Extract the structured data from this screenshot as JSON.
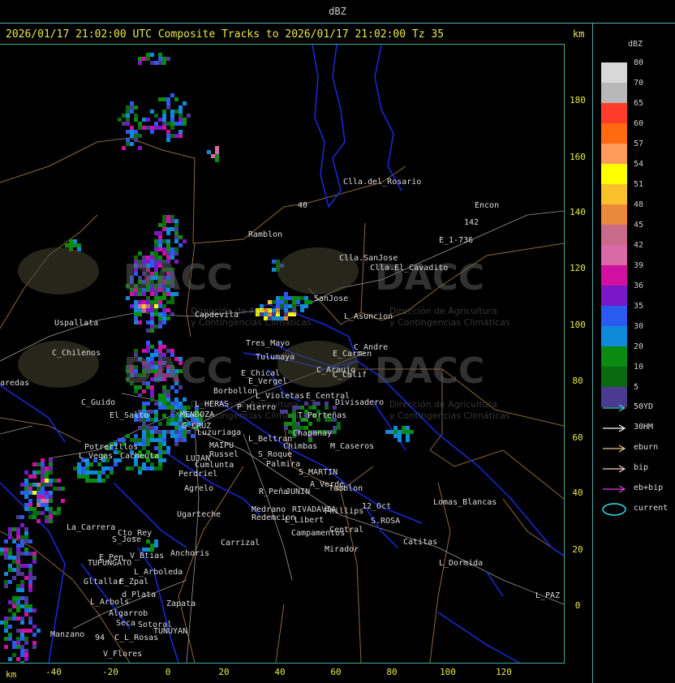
{
  "window": {
    "title": "dBZ"
  },
  "header": {
    "text": "2026/01/17 21:02:00 UTC Composite Tracks to 2026/01/17 21:02:00 Tz 35",
    "km_label": "km"
  },
  "axes": {
    "x_unit": "km",
    "x_ticks": [
      "-40",
      "-20",
      "0",
      "20",
      "40",
      "60",
      "80",
      "100",
      "120"
    ],
    "y_ticks": [
      "180",
      "160",
      "140",
      "120",
      "100",
      "80",
      "60",
      "40",
      "20",
      "0"
    ]
  },
  "legend": {
    "title": "dBZ",
    "scale": [
      {
        "value": "80",
        "color": "#d8d8d8"
      },
      {
        "value": "70",
        "color": "#b8b8b8"
      },
      {
        "value": "65",
        "color": "#ff3c2a"
      },
      {
        "value": "60",
        "color": "#ff6a10"
      },
      {
        "value": "57",
        "color": "#ff9a5a"
      },
      {
        "value": "54",
        "color": "#ffff00"
      },
      {
        "value": "51",
        "color": "#f8c02a"
      },
      {
        "value": "48",
        "color": "#e88a3a"
      },
      {
        "value": "45",
        "color": "#c86a8a"
      },
      {
        "value": "42",
        "color": "#d86aa8"
      },
      {
        "value": "39",
        "color": "#d010a0"
      },
      {
        "value": "36",
        "color": "#7a18c8"
      },
      {
        "value": "35",
        "color": "#2a5af0"
      },
      {
        "value": "30",
        "color": "#108ad8"
      },
      {
        "value": "20",
        "color": "#0a8a10"
      },
      {
        "value": "10",
        "color": "#0a6a10"
      },
      {
        "value": "5",
        "color": "#4a3a90"
      }
    ],
    "tracks": [
      {
        "label": "50YD",
        "color": "#40d0d8"
      },
      {
        "label": "30HM",
        "color": "#ffffff"
      },
      {
        "label": "eburn",
        "color": "#e8c890"
      },
      {
        "label": "bip",
        "color": "#f8d0d8"
      },
      {
        "label": "eb+bip",
        "color": "#e040e0"
      },
      {
        "label": "current",
        "color": "#30e0f0"
      }
    ]
  },
  "watermark": {
    "name": "DACC",
    "line1": "Dirección de Agricultura",
    "line2": "y Contingencias Climáticas"
  },
  "places": [
    {
      "name": "Clla.del_Rosario"
    },
    {
      "name": "Encon"
    },
    {
      "name": "142"
    },
    {
      "name": "E_1-736"
    },
    {
      "name": "Ramblon"
    },
    {
      "name": "Clla.SanJose"
    },
    {
      "name": "Clla.El_Cavadito"
    },
    {
      "name": "SanJose"
    },
    {
      "name": "Capdevila"
    },
    {
      "name": "L_Asuncion"
    },
    {
      "name": "Uspallata"
    },
    {
      "name": "Tres_Mayo"
    },
    {
      "name": "C_Andre"
    },
    {
      "name": "Tulumaya"
    },
    {
      "name": "E_Carmen"
    },
    {
      "name": "C_Chilenos"
    },
    {
      "name": "C_Araujo"
    },
    {
      "name": "C_Calif"
    },
    {
      "name": "E_Chical"
    },
    {
      "name": "E_Vergel"
    },
    {
      "name": "aredas"
    },
    {
      "name": "Borbollon"
    },
    {
      "name": "L_Violetas"
    },
    {
      "name": "E_Central"
    },
    {
      "name": "Divisadero"
    },
    {
      "name": "C_Guido"
    },
    {
      "name": "L_HERAS"
    },
    {
      "name": "P_Hierro"
    },
    {
      "name": "El_Salto"
    },
    {
      "name": "MENDOZA"
    },
    {
      "name": "T_Porteñas"
    },
    {
      "name": "G_CRUZ"
    },
    {
      "name": "Luzuriaga"
    },
    {
      "name": "Chapanay"
    },
    {
      "name": "L_Beltran"
    },
    {
      "name": "Potrerillos"
    },
    {
      "name": "MAIPU"
    },
    {
      "name": "Chimbas"
    },
    {
      "name": "M_Caseros"
    },
    {
      "name": "L_Vegas"
    },
    {
      "name": "Cacheuta"
    },
    {
      "name": "Russel"
    },
    {
      "name": "LUJAN"
    },
    {
      "name": "S_Roque"
    },
    {
      "name": "Cumlunta"
    },
    {
      "name": "Palmira"
    },
    {
      "name": "S_MARTIN"
    },
    {
      "name": "Perdriel"
    },
    {
      "name": "A_Verde"
    },
    {
      "name": "Agrelo"
    },
    {
      "name": "Tamblon"
    },
    {
      "name": "R_Peña"
    },
    {
      "name": "JUNIN"
    },
    {
      "name": "Lomas_Blancas"
    },
    {
      "name": "Ugarteche"
    },
    {
      "name": "Medrano"
    },
    {
      "name": "RIVADAVIA"
    },
    {
      "name": "Phillips"
    },
    {
      "name": "12_Oct"
    },
    {
      "name": "L_Libert"
    },
    {
      "name": "Redemcion"
    },
    {
      "name": "S.ROSA"
    },
    {
      "name": "La_Carrera"
    },
    {
      "name": "Cto_Rey"
    },
    {
      "name": "Campamentos"
    },
    {
      "name": "Central"
    },
    {
      "name": "Carrizal"
    },
    {
      "name": "Catitas"
    },
    {
      "name": "S_Jose"
    },
    {
      "name": "V_Btias"
    },
    {
      "name": "Anchoris"
    },
    {
      "name": "E_Pen"
    },
    {
      "name": "TUPUNGATO"
    },
    {
      "name": "Mirador"
    },
    {
      "name": "L_Dormida"
    },
    {
      "name": "L_Arboleda"
    },
    {
      "name": "Gltallar"
    },
    {
      "name": "E_Zpal"
    },
    {
      "name": "d_Plata"
    },
    {
      "name": "L_PAZ"
    },
    {
      "name": "L_Arbols"
    },
    {
      "name": "Zapata"
    },
    {
      "name": "Algarrob"
    },
    {
      "name": "Seca"
    },
    {
      "name": "Sotoral"
    },
    {
      "name": "TUNUYAN"
    },
    {
      "name": "Manzano"
    },
    {
      "name": "94"
    },
    {
      "name": "C_L_Rosas"
    },
    {
      "name": "V_Flores"
    },
    {
      "name": "40"
    }
  ]
}
